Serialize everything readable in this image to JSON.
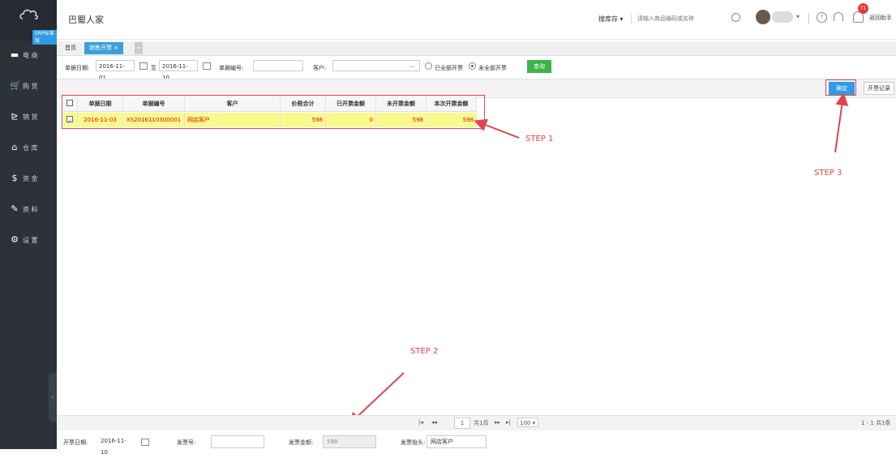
{
  "sidebar": {
    "logo_tag": "ERP标准版",
    "items": [
      {
        "icon": "shop-icon",
        "label": "电 商"
      },
      {
        "icon": "cart-icon",
        "label": "购 货"
      },
      {
        "icon": "sale-icon",
        "label": "销 货"
      },
      {
        "icon": "warehouse-icon",
        "label": "仓 库"
      },
      {
        "icon": "money-icon",
        "label": "资 金"
      },
      {
        "icon": "pen-icon",
        "label": "资 料"
      },
      {
        "icon": "gear-icon",
        "label": "设 置"
      }
    ],
    "collapse_label": "‹"
  },
  "header": {
    "title": "巴蜀人家",
    "search_type": "搜库存",
    "search_placeholder": "请输入商品编码或名称",
    "notification_count": "71",
    "return_label": "返回助手"
  },
  "tabs": {
    "home": "首页",
    "active": "销售开票 ×",
    "more": "▾"
  },
  "filter": {
    "date_label": "单据日期:",
    "date_from": "2016-11-01",
    "to_label": "至",
    "date_to": "2016-11-10",
    "doc_no_label": "单据编号:",
    "doc_no_value": "",
    "customer_label": "客户:",
    "customer_value": "",
    "customer_more": "···",
    "radio_all": "已全部开票",
    "radio_partial": "未全部开票",
    "query_button": "查询"
  },
  "actions": {
    "confirm_button": "确定",
    "records_button": "开票记录"
  },
  "table": {
    "columns": [
      "单据日期",
      "单据编号",
      "客户",
      "价税合计",
      "已开票金额",
      "未开票金额",
      "本次开票金额"
    ],
    "rows": [
      {
        "date": "2016-11-03",
        "doc_no": "XS2016110300001",
        "customer": "网店客户",
        "total": "598",
        "invoiced": "0",
        "uninvoiced": "598",
        "this_invoice": "598"
      }
    ]
  },
  "annotations": {
    "step1": "STEP 1",
    "step2": "STEP 2",
    "step3": "STEP 3"
  },
  "pager": {
    "first": "|◂",
    "prev": "◂◂",
    "page": "1",
    "total_pages": "共1页",
    "next": "▸▸",
    "last": "▸|",
    "page_size": "100",
    "summary": "1 - 1  共1条"
  },
  "invoice": {
    "date_label": "开票日期:",
    "date_value": "2016-11-10",
    "number_label": "发票号:",
    "number_value": "",
    "amount_label": "发票金额:",
    "amount_value": "598",
    "title_label": "发票抬头:",
    "title_value": "网店客户"
  },
  "colors": {
    "sidebar_bg": "#2c313a",
    "accent_blue": "#2e9be6",
    "query_green": "#3bb449",
    "annotation_red": "#e0454c",
    "selected_row": "#fafa8c"
  }
}
